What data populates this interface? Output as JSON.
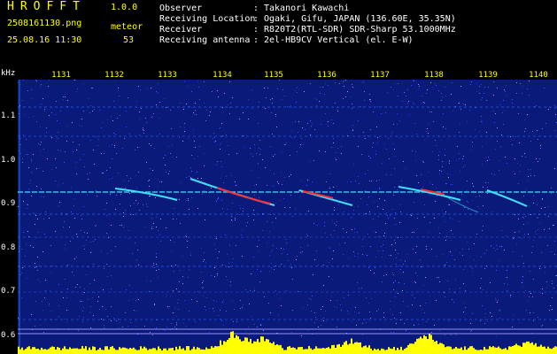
{
  "header": {
    "app_title": "HROFFT",
    "version": "1.0.0",
    "filename": "2508161130.png",
    "meteor_label": "meteor",
    "timestamp": "25.08.16 11:30",
    "meteor_count": "53",
    "rows": [
      {
        "label": "Observer",
        "value": "Takanori Kawachi"
      },
      {
        "label": "Receiving Location",
        "value": "Ogaki, Gifu, JAPAN (136.60E, 35.35N)"
      },
      {
        "label": "Receiver",
        "value": "R820T2(RTL-SDR) SDR-Sharp 53.1000MHz"
      },
      {
        "label": "Receiving antenna",
        "value": "2el-HB9CV Vertical (el. E-W)"
      }
    ]
  },
  "axis": {
    "y_unit": "kHz",
    "x_ticks": [
      "1131",
      "1132",
      "1133",
      "1134",
      "1135",
      "1136",
      "1137",
      "1138",
      "1139",
      "1140"
    ],
    "y_ticks": [
      "1.1",
      "1.0",
      "0.9",
      "0.8",
      "0.7",
      "0.6"
    ]
  },
  "colors": {
    "background": "#000000",
    "label_white": "#ffffff",
    "label_yellow": "#ffff00",
    "noise_blue": "#0a1a7a",
    "signal_cyan": "#40e0ff",
    "meteor_red": "#ff3030",
    "level_yellow": "#ffff00"
  }
}
